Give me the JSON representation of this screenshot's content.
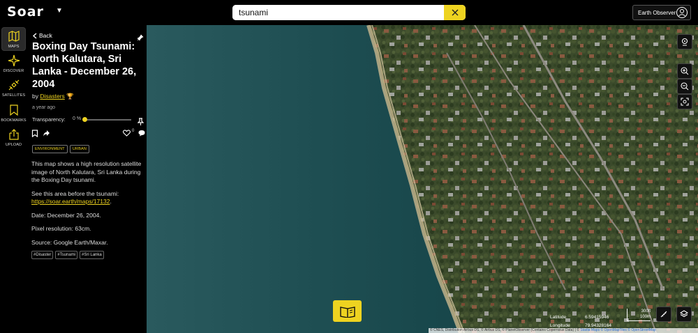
{
  "header": {
    "logo": "Soar",
    "search_value": "tsunami",
    "user_label": "Earth Observer"
  },
  "nav": {
    "items": [
      {
        "label": "MAPS",
        "icon": "map-icon"
      },
      {
        "label": "DISCOVER",
        "icon": "compass-icon"
      },
      {
        "label": "SATELLITES",
        "icon": "satellite-icon"
      },
      {
        "label": "BOOKMARKS",
        "icon": "bookmark-icon"
      },
      {
        "label": "UPLOAD",
        "icon": "upload-icon"
      }
    ]
  },
  "panel": {
    "back_label": "Back",
    "title": "Boxing Day Tsunami: North Kalutara, Sri Lanka - December 26, 2004",
    "by_prefix": "by",
    "author": "Disasters",
    "time_ago": "a year ago",
    "transparency_label": "Transparency:",
    "transparency_value": "0 %",
    "transparency_fraction": 0,
    "tags": [
      "ENVIRONMENT",
      "URBAN"
    ],
    "description": {
      "p1": "This map shows a high resolution satellite image of North Kalutara, Sri Lanka during the Boxing Day tsunami.",
      "p2_prefix": "See this area before the tsunami:",
      "p2_link": "https://soar.earth/maps/17132",
      "p2_suffix": ".",
      "p3": "Date: December 26, 2004.",
      "p4": "Pixel resolution: 63cm.",
      "p5": "Source: Google Earth/Maxar."
    },
    "hashtags": [
      "#Disaster",
      "#Tsunami",
      "#Sri Lanka"
    ]
  },
  "map": {
    "latitude_label": "Latitude",
    "latitude_value": "6.59415946",
    "longitude_label": "Longitude",
    "longitude_value": "79.94328164",
    "scale_ft": "300ft",
    "scale_m": "100m",
    "attribution_prefix": "© CNES, Distribution Airbus DS, © Airbus DS, © PlanetObserver (Contains Copernicus Data) | ©",
    "attribution_links": [
      "Stadia Maps",
      "© OpenMapTiles",
      "© OpenStreetMap"
    ]
  },
  "colors": {
    "accent": "#eed320",
    "background": "#000000",
    "sea": "#1f4b50",
    "land": "#3c4a2c"
  }
}
